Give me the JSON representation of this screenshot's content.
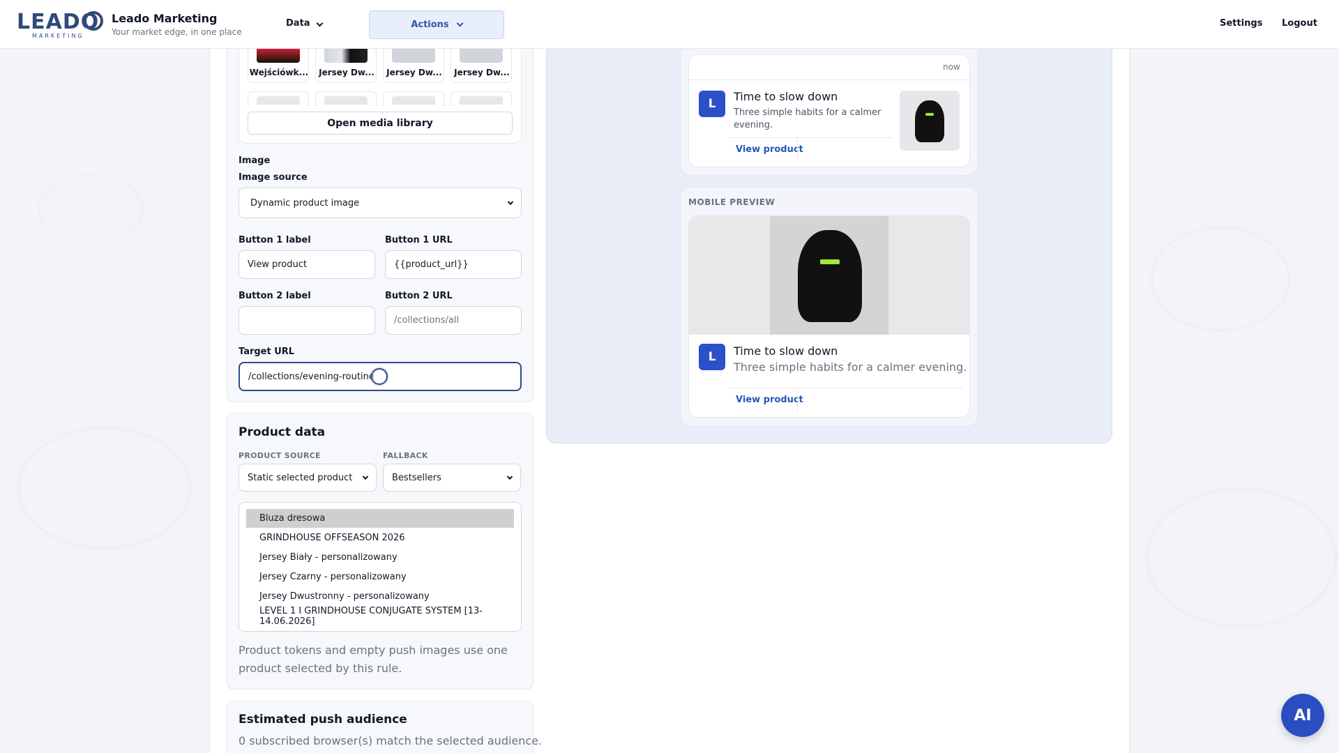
{
  "header": {
    "logo_text": "LEADO",
    "logo_sub": "MARKETING",
    "brand_name": "Leado Marketing",
    "brand_tagline": "Your market edge, in one place",
    "nav_data": "Data",
    "nav_actions": "Actions",
    "nav_settings": "Settings",
    "nav_logout": "Logout"
  },
  "media": {
    "thumbs": [
      "Wejściówk...",
      "Jersey Dw...",
      "Jersey Dw...",
      "Jersey Dw..."
    ],
    "open_library_label": "Open media library"
  },
  "form": {
    "image_heading": "Image",
    "image_source_label": "Image source",
    "image_source_value": "Dynamic product image",
    "button1_label_label": "Button 1 label",
    "button1_label_value": "View product",
    "button1_url_label": "Button 1 URL",
    "button1_url_value": "{{product_url}}",
    "button2_label_label": "Button 2 label",
    "button2_label_value": "",
    "button2_url_label": "Button 2 URL",
    "button2_url_placeholder": "/collections/all",
    "target_url_label": "Target URL",
    "target_url_value": "/collections/evening-routine"
  },
  "product_data": {
    "title": "Product data",
    "source_label": "PRODUCT SOURCE",
    "source_value": "Static selected product",
    "fallback_label": "FALLBACK",
    "fallback_value": "Bestsellers",
    "options": [
      "Bluza dresowa",
      "GRINDHOUSE OFFSEASON 2026",
      "Jersey Biały - personalizowany",
      "Jersey Czarny - personalizowany",
      "Jersey Dwustronny - personalizowany",
      "LEVEL 1 I GRINDHOUSE CONJUGATE SYSTEM [13-14.06.2026]"
    ],
    "selected_index": 0,
    "help_text": "Product tokens and empty push images use one product selected by this rule."
  },
  "audience": {
    "title": "Estimated push audience",
    "text": "0 subscribed browser(s) match the selected audience."
  },
  "desktop_preview": {
    "time": "now",
    "avatar": "L",
    "title": "Time to slow down",
    "body": "Three simple habits for a calmer evening.",
    "button": "View product"
  },
  "mobile_preview": {
    "label": "MOBILE PREVIEW",
    "avatar": "L",
    "title": "Time to slow down",
    "body": "Three simple habits for a calmer evening.",
    "button": "View product"
  },
  "ai_button": "AI",
  "colors": {
    "accent": "#2c50c8",
    "link": "#2558b8",
    "focus": "#2c4a86"
  }
}
